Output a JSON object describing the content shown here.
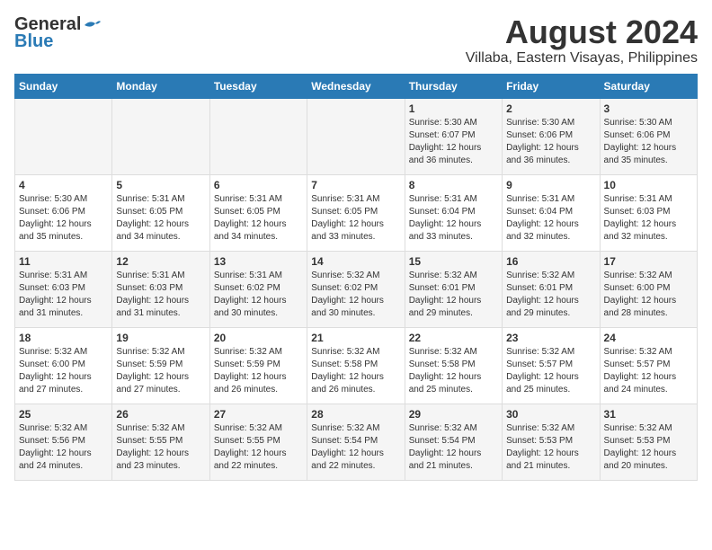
{
  "logo": {
    "line1": "General",
    "line2": "Blue"
  },
  "title": "August 2024",
  "subtitle": "Villaba, Eastern Visayas, Philippines",
  "days": [
    "Sunday",
    "Monday",
    "Tuesday",
    "Wednesday",
    "Thursday",
    "Friday",
    "Saturday"
  ],
  "weeks": [
    [
      {
        "date": "",
        "info": ""
      },
      {
        "date": "",
        "info": ""
      },
      {
        "date": "",
        "info": ""
      },
      {
        "date": "",
        "info": ""
      },
      {
        "date": "1",
        "info": "Sunrise: 5:30 AM\nSunset: 6:07 PM\nDaylight: 12 hours\nand 36 minutes."
      },
      {
        "date": "2",
        "info": "Sunrise: 5:30 AM\nSunset: 6:06 PM\nDaylight: 12 hours\nand 36 minutes."
      },
      {
        "date": "3",
        "info": "Sunrise: 5:30 AM\nSunset: 6:06 PM\nDaylight: 12 hours\nand 35 minutes."
      }
    ],
    [
      {
        "date": "4",
        "info": "Sunrise: 5:30 AM\nSunset: 6:06 PM\nDaylight: 12 hours\nand 35 minutes."
      },
      {
        "date": "5",
        "info": "Sunrise: 5:31 AM\nSunset: 6:05 PM\nDaylight: 12 hours\nand 34 minutes."
      },
      {
        "date": "6",
        "info": "Sunrise: 5:31 AM\nSunset: 6:05 PM\nDaylight: 12 hours\nand 34 minutes."
      },
      {
        "date": "7",
        "info": "Sunrise: 5:31 AM\nSunset: 6:05 PM\nDaylight: 12 hours\nand 33 minutes."
      },
      {
        "date": "8",
        "info": "Sunrise: 5:31 AM\nSunset: 6:04 PM\nDaylight: 12 hours\nand 33 minutes."
      },
      {
        "date": "9",
        "info": "Sunrise: 5:31 AM\nSunset: 6:04 PM\nDaylight: 12 hours\nand 32 minutes."
      },
      {
        "date": "10",
        "info": "Sunrise: 5:31 AM\nSunset: 6:03 PM\nDaylight: 12 hours\nand 32 minutes."
      }
    ],
    [
      {
        "date": "11",
        "info": "Sunrise: 5:31 AM\nSunset: 6:03 PM\nDaylight: 12 hours\nand 31 minutes."
      },
      {
        "date": "12",
        "info": "Sunrise: 5:31 AM\nSunset: 6:03 PM\nDaylight: 12 hours\nand 31 minutes."
      },
      {
        "date": "13",
        "info": "Sunrise: 5:31 AM\nSunset: 6:02 PM\nDaylight: 12 hours\nand 30 minutes."
      },
      {
        "date": "14",
        "info": "Sunrise: 5:32 AM\nSunset: 6:02 PM\nDaylight: 12 hours\nand 30 minutes."
      },
      {
        "date": "15",
        "info": "Sunrise: 5:32 AM\nSunset: 6:01 PM\nDaylight: 12 hours\nand 29 minutes."
      },
      {
        "date": "16",
        "info": "Sunrise: 5:32 AM\nSunset: 6:01 PM\nDaylight: 12 hours\nand 29 minutes."
      },
      {
        "date": "17",
        "info": "Sunrise: 5:32 AM\nSunset: 6:00 PM\nDaylight: 12 hours\nand 28 minutes."
      }
    ],
    [
      {
        "date": "18",
        "info": "Sunrise: 5:32 AM\nSunset: 6:00 PM\nDaylight: 12 hours\nand 27 minutes."
      },
      {
        "date": "19",
        "info": "Sunrise: 5:32 AM\nSunset: 5:59 PM\nDaylight: 12 hours\nand 27 minutes."
      },
      {
        "date": "20",
        "info": "Sunrise: 5:32 AM\nSunset: 5:59 PM\nDaylight: 12 hours\nand 26 minutes."
      },
      {
        "date": "21",
        "info": "Sunrise: 5:32 AM\nSunset: 5:58 PM\nDaylight: 12 hours\nand 26 minutes."
      },
      {
        "date": "22",
        "info": "Sunrise: 5:32 AM\nSunset: 5:58 PM\nDaylight: 12 hours\nand 25 minutes."
      },
      {
        "date": "23",
        "info": "Sunrise: 5:32 AM\nSunset: 5:57 PM\nDaylight: 12 hours\nand 25 minutes."
      },
      {
        "date": "24",
        "info": "Sunrise: 5:32 AM\nSunset: 5:57 PM\nDaylight: 12 hours\nand 24 minutes."
      }
    ],
    [
      {
        "date": "25",
        "info": "Sunrise: 5:32 AM\nSunset: 5:56 PM\nDaylight: 12 hours\nand 24 minutes."
      },
      {
        "date": "26",
        "info": "Sunrise: 5:32 AM\nSunset: 5:55 PM\nDaylight: 12 hours\nand 23 minutes."
      },
      {
        "date": "27",
        "info": "Sunrise: 5:32 AM\nSunset: 5:55 PM\nDaylight: 12 hours\nand 22 minutes."
      },
      {
        "date": "28",
        "info": "Sunrise: 5:32 AM\nSunset: 5:54 PM\nDaylight: 12 hours\nand 22 minutes."
      },
      {
        "date": "29",
        "info": "Sunrise: 5:32 AM\nSunset: 5:54 PM\nDaylight: 12 hours\nand 21 minutes."
      },
      {
        "date": "30",
        "info": "Sunrise: 5:32 AM\nSunset: 5:53 PM\nDaylight: 12 hours\nand 21 minutes."
      },
      {
        "date": "31",
        "info": "Sunrise: 5:32 AM\nSunset: 5:53 PM\nDaylight: 12 hours\nand 20 minutes."
      }
    ]
  ]
}
